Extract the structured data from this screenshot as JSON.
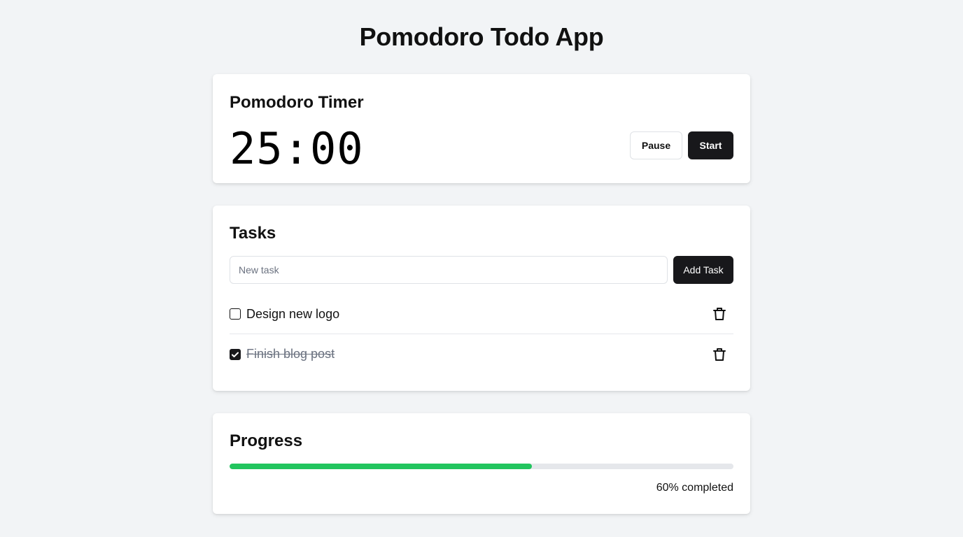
{
  "app": {
    "title": "Pomodoro Todo App"
  },
  "timer": {
    "title": "Pomodoro Timer",
    "display": "25:00",
    "pause_label": "Pause",
    "start_label": "Start"
  },
  "tasks": {
    "title": "Tasks",
    "input_placeholder": "New task",
    "input_value": "",
    "add_label": "Add Task",
    "items": [
      {
        "label": "Design new logo",
        "completed": false
      },
      {
        "label": "Finish blog post",
        "completed": true
      }
    ]
  },
  "progress": {
    "title": "Progress",
    "percent": 60,
    "text": "60% completed"
  },
  "colors": {
    "accent_dark": "#18181b",
    "progress_fill": "#22c55e",
    "background": "#f2f4f6"
  },
  "icons": {
    "delete": "trash-icon",
    "checked": "check-icon"
  }
}
